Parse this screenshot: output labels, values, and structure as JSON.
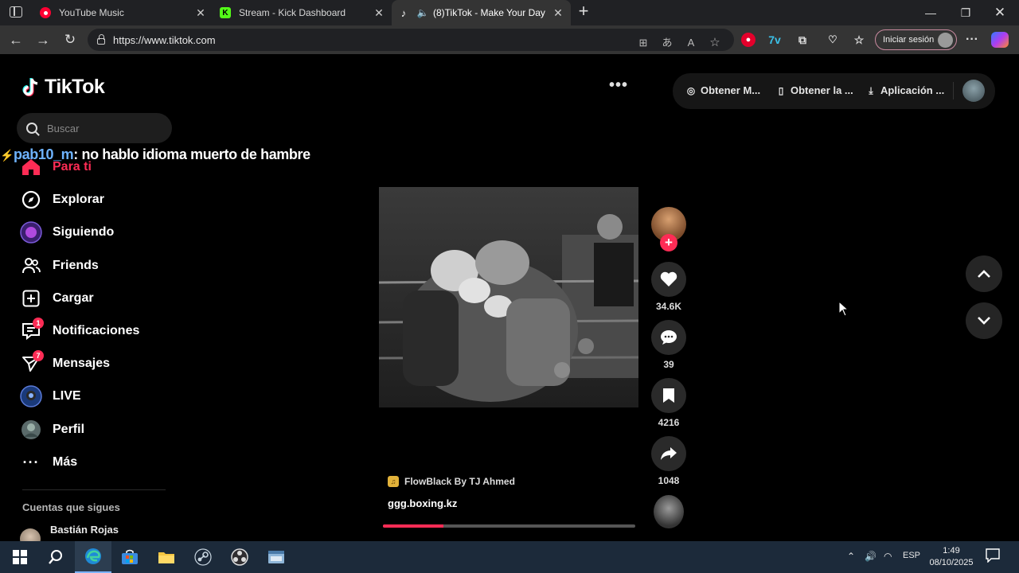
{
  "browser": {
    "tabs": [
      {
        "title": "YouTube Music",
        "icon": "youtube-music-icon",
        "color": "#ff0033",
        "active": false
      },
      {
        "title": "Stream - Kick Dashboard",
        "icon": "kick-icon",
        "color": "#53fc18",
        "active": false
      },
      {
        "title": "(8)TikTok - Make Your Day",
        "icon": "tiktok-icon",
        "color": "#ffffff",
        "active": true
      }
    ],
    "url": "https://www.tiktok.com",
    "signin_label": "Iniciar sesión"
  },
  "tiktok": {
    "logo": "TikTok",
    "search_placeholder": "Buscar",
    "nav": [
      {
        "label": "Para ti",
        "icon": "home-icon",
        "active": true
      },
      {
        "label": "Explorar",
        "icon": "compass-icon"
      },
      {
        "label": "Siguiendo",
        "icon": "following-icon"
      },
      {
        "label": "Friends",
        "icon": "friends-icon"
      },
      {
        "label": "Cargar",
        "icon": "upload-icon"
      },
      {
        "label": "Notificaciones",
        "icon": "notifications-icon",
        "badge": "1"
      },
      {
        "label": "Mensajes",
        "icon": "messages-icon",
        "badge": "7"
      },
      {
        "label": "LIVE",
        "icon": "live-icon"
      },
      {
        "label": "Perfil",
        "icon": "profile-icon"
      },
      {
        "label": "Más",
        "icon": "more-icon"
      }
    ],
    "following_title": "Cuentas que sigues",
    "following": [
      {
        "name": "Bastián Rojas"
      }
    ],
    "top_actions": [
      {
        "label": "Obtener M...",
        "icon": "coins-icon"
      },
      {
        "label": "Obtener la ...",
        "icon": "phone-icon"
      },
      {
        "label": "Aplicación ...",
        "icon": "download-icon"
      }
    ],
    "video": {
      "music": "FlowBlack By TJ Ahmed",
      "author": "ggg.boxing.kz",
      "progress": 0.24,
      "likes": "34.6K",
      "comments": "39",
      "saves": "4216",
      "shares": "1048"
    }
  },
  "overlay_chat": {
    "user": "pab10_m",
    "message": ": no hablo idioma muerto de hambre"
  },
  "taskbar": {
    "language": "ESP",
    "time": "1:49",
    "date": "08/10/2025"
  }
}
